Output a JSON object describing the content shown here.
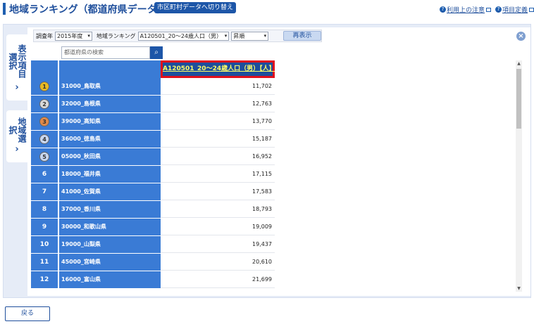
{
  "header": {
    "title": "地域ランキング（都道府県データ）",
    "switch_button": "市区町村データへ切り替え",
    "links": [
      {
        "label": "利用上の注意"
      },
      {
        "label": "項目定義"
      }
    ]
  },
  "side_tabs": [
    {
      "label": "表示項目選択"
    },
    {
      "label": "地域選択"
    }
  ],
  "filters": {
    "year_label": "調査年",
    "year_value": "2015年度",
    "ranking_label": "地域ランキング",
    "ranking_value": "A120501_20～24歳人口（男）",
    "order_value": "昇順",
    "redisplay_button": "再表示"
  },
  "search": {
    "placeholder": "都道府県の検索",
    "icon": "search-icon"
  },
  "table": {
    "value_header": "A120501_20～24歳人口（男）【人】",
    "rows": [
      {
        "rank": "1",
        "name": "31000_鳥取県",
        "value": "11,702",
        "medal": "gold"
      },
      {
        "rank": "2",
        "name": "32000_島根県",
        "value": "12,763",
        "medal": "silver"
      },
      {
        "rank": "3",
        "name": "39000_高知県",
        "value": "13,770",
        "medal": "bronze"
      },
      {
        "rank": "4",
        "name": "36000_徳島県",
        "value": "15,187",
        "medal": "blue"
      },
      {
        "rank": "5",
        "name": "05000_秋田県",
        "value": "16,952",
        "medal": "blue"
      },
      {
        "rank": "6",
        "name": "18000_福井県",
        "value": "17,115"
      },
      {
        "rank": "7",
        "name": "41000_佐賀県",
        "value": "17,583"
      },
      {
        "rank": "8",
        "name": "37000_香川県",
        "value": "18,793"
      },
      {
        "rank": "9",
        "name": "30000_和歌山県",
        "value": "19,009"
      },
      {
        "rank": "10",
        "name": "19000_山梨県",
        "value": "19,437"
      },
      {
        "rank": "11",
        "name": "45000_宮崎県",
        "value": "20,610"
      },
      {
        "rank": "12",
        "name": "16000_富山県",
        "value": "21,699"
      }
    ]
  },
  "colors": {
    "brand": "#1f4f9c",
    "header_cell": "#3a7bd5",
    "highlight_border": "#e0101c"
  },
  "footer": {
    "back_button": "戻る"
  }
}
